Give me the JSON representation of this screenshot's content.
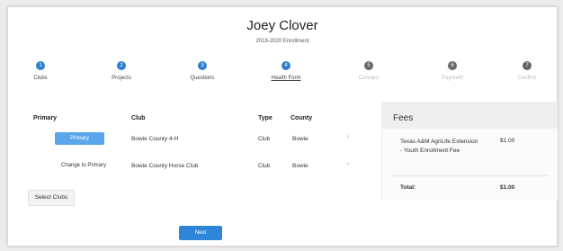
{
  "header": {
    "name": "Joey Clover",
    "enrollment": "2019-2020 Enrollment"
  },
  "steps": [
    {
      "number": "1",
      "label": "Clubs"
    },
    {
      "number": "2",
      "label": "Projects"
    },
    {
      "number": "3",
      "label": "Questions"
    },
    {
      "number": "4",
      "label": "Health Form"
    },
    {
      "number": "5",
      "label": "Consent"
    },
    {
      "number": "6",
      "label": "Payment"
    },
    {
      "number": "7",
      "label": "Confirm"
    }
  ],
  "clubs_table": {
    "headers": {
      "primary": "Primary",
      "club": "Club",
      "type": "Type",
      "county": "County"
    },
    "rows": [
      {
        "primary_button": "Primary",
        "club": "Bowie County 4-H",
        "type": "Club",
        "county": "Bowie"
      },
      {
        "primary_button": "Change to Primary",
        "club": "Bowie County Horse Club",
        "type": "Club",
        "county": "Bowie"
      }
    ]
  },
  "actions": {
    "select_clubs": "Select Clubs",
    "next": "Next"
  },
  "fees": {
    "title": "Fees",
    "items": [
      {
        "name": "Texas A&M AgriLife Extension - Youth Enrollment Fee",
        "amount": "$1.00"
      }
    ],
    "total_label": "Total:",
    "total_amount": "$1.00"
  },
  "colors": {
    "accent": "#2f7fd0",
    "button_primary": "#5aa6ea",
    "inactive_step": "#666666"
  }
}
